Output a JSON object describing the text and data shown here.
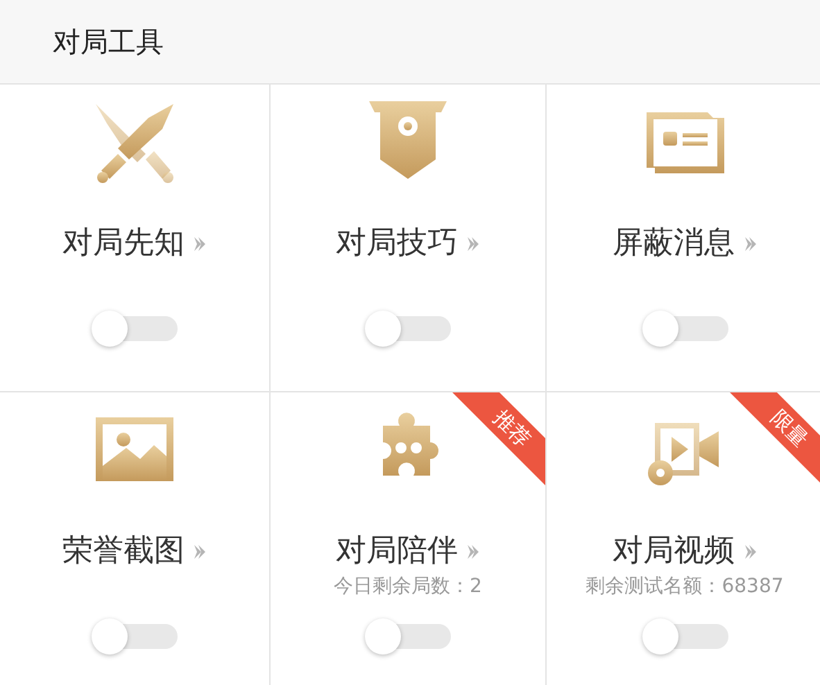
{
  "header": {
    "title": "对局工具"
  },
  "tools": [
    {
      "label": "对局先知",
      "on": false
    },
    {
      "label": "对局技巧",
      "on": false
    },
    {
      "label": "屏蔽消息",
      "on": false
    },
    {
      "label": "荣誉截图",
      "on": false
    },
    {
      "label": "对局陪伴",
      "note": "今日剩余局数：2",
      "ribbon": "推荐",
      "on": false
    },
    {
      "label": "对局视频",
      "note": "剩余测试名额：68387",
      "ribbon": "限量",
      "on": false
    }
  ]
}
